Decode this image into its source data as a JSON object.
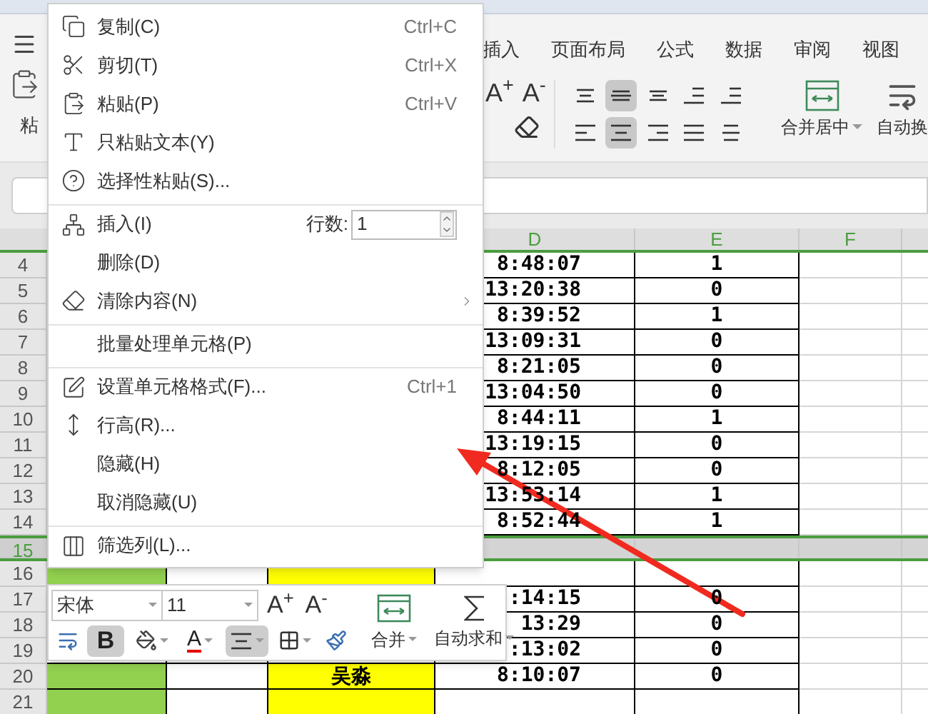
{
  "ribbon": {
    "paste_label": "粘",
    "tabs": [
      "插入",
      "页面布局",
      "公式",
      "数据",
      "审阅",
      "视图"
    ],
    "font_grow": "A$^{+}$",
    "font_shrink": "A$^{-}$",
    "align_buttons": [
      {
        "selected": false
      },
      {
        "selected": true
      },
      {
        "selected": false
      },
      {
        "selected": false
      },
      {
        "selected": false
      },
      {
        "selected": false
      },
      {
        "selected": true
      },
      {
        "selected": false
      },
      {
        "selected": false
      },
      {
        "selected": false
      }
    ],
    "merge_label": "合并居中",
    "wrap_label": "自动换"
  },
  "columns": [
    "D",
    "E",
    "F"
  ],
  "rows": [
    {
      "number": "4",
      "selected": false,
      "d": "8:48:07",
      "e": "1"
    },
    {
      "number": "5",
      "selected": false,
      "d": "13:20:38",
      "e": "0"
    },
    {
      "number": "6",
      "selected": false,
      "d": "8:39:52",
      "e": "1"
    },
    {
      "number": "7",
      "selected": false,
      "d": "13:09:31",
      "e": "0"
    },
    {
      "number": "8",
      "selected": false,
      "d": "8:21:05",
      "e": "0"
    },
    {
      "number": "9",
      "selected": false,
      "d": "13:04:50",
      "e": "0"
    },
    {
      "number": "10",
      "selected": false,
      "d": "8:44:11",
      "e": "1"
    },
    {
      "number": "11",
      "selected": false,
      "d": "13:19:15",
      "e": "0"
    },
    {
      "number": "12",
      "selected": false,
      "d": "8:12:05",
      "e": "0"
    },
    {
      "number": "13",
      "selected": false,
      "d": "13:53:14",
      "e": "1"
    },
    {
      "number": "14",
      "selected": false,
      "d": "8:52:44",
      "e": "1"
    },
    {
      "number": "15",
      "selected": true
    },
    {
      "number": "16",
      "selected": false,
      "a": {
        "color": "#92d050"
      },
      "c": {
        "color": "#ffff00"
      }
    },
    {
      "number": "17",
      "selected": false,
      "d": ":14:15",
      "e": "0"
    },
    {
      "number": "18",
      "selected": false,
      "d": "13:29",
      "e": "0"
    },
    {
      "number": "19",
      "selected": false,
      "d": ":13:02",
      "e": "0"
    },
    {
      "number": "20",
      "selected": false,
      "a": {
        "color": "#92d050"
      },
      "c": {
        "color": "#ffff00",
        "text": "吴淼"
      },
      "d": "8:10:07",
      "e": "0"
    },
    {
      "number": "21",
      "selected": false,
      "a": {
        "color": "#92d050"
      },
      "c": {
        "color": "#ffff00"
      }
    }
  ],
  "context_menu": {
    "items": [
      {
        "kind": "command",
        "label": "复制(C)",
        "shortcut": "Ctrl+C",
        "separator_before": false,
        "submenu": false
      },
      {
        "kind": "command",
        "label": "剪切(T)",
        "shortcut": "Ctrl+X",
        "separator_before": false,
        "submenu": false
      },
      {
        "kind": "command",
        "label": "粘贴(P)",
        "shortcut": "Ctrl+V",
        "separator_before": false,
        "submenu": false
      },
      {
        "kind": "command",
        "label": "只粘贴文本(Y)",
        "separator_before": false,
        "submenu": false
      },
      {
        "kind": "command",
        "label": "选择性粘贴(S)...",
        "separator_before": false,
        "submenu": false
      },
      {
        "kind": "count",
        "label": "插入(I)",
        "count_label": "行数:",
        "count_value": "1",
        "separator_before": true,
        "submenu": false
      },
      {
        "kind": "command",
        "label": "删除(D)",
        "separator_before": false,
        "submenu": false
      },
      {
        "kind": "command",
        "label": "清除内容(N)",
        "separator_before": false,
        "submenu": true
      },
      {
        "kind": "command",
        "label": "批量处理单元格(P)",
        "separator_before": true,
        "submenu": false
      },
      {
        "kind": "command",
        "label": "设置单元格格式(F)...",
        "shortcut": "Ctrl+1",
        "separator_before": true,
        "submenu": false
      },
      {
        "kind": "command",
        "label": "行高(R)...",
        "separator_before": false,
        "submenu": false
      },
      {
        "kind": "command",
        "label": "隐藏(H)",
        "separator_before": false,
        "submenu": false
      },
      {
        "kind": "command",
        "label": "取消隐藏(U)",
        "separator_before": false,
        "submenu": false
      },
      {
        "kind": "command",
        "label": "筛选列(L)...",
        "separator_before": true,
        "submenu": false
      }
    ]
  },
  "mini_toolbar": {
    "font": "宋体",
    "size": "11",
    "grow": "A$^{+}$",
    "shrink": "A$^{-}$",
    "tools": [
      {
        "kind": "wrap",
        "selected": false
      },
      {
        "kind": "bold",
        "label": "B",
        "selected": true
      },
      {
        "kind": "fill",
        "selected": false
      },
      {
        "kind": "font_color",
        "label": "A",
        "selected": false
      },
      {
        "kind": "align",
        "selected": true
      },
      {
        "kind": "borders",
        "selected": false
      },
      {
        "kind": "brush",
        "selected": false
      }
    ],
    "merge_label": "合并",
    "sum_label": "自动求和"
  }
}
